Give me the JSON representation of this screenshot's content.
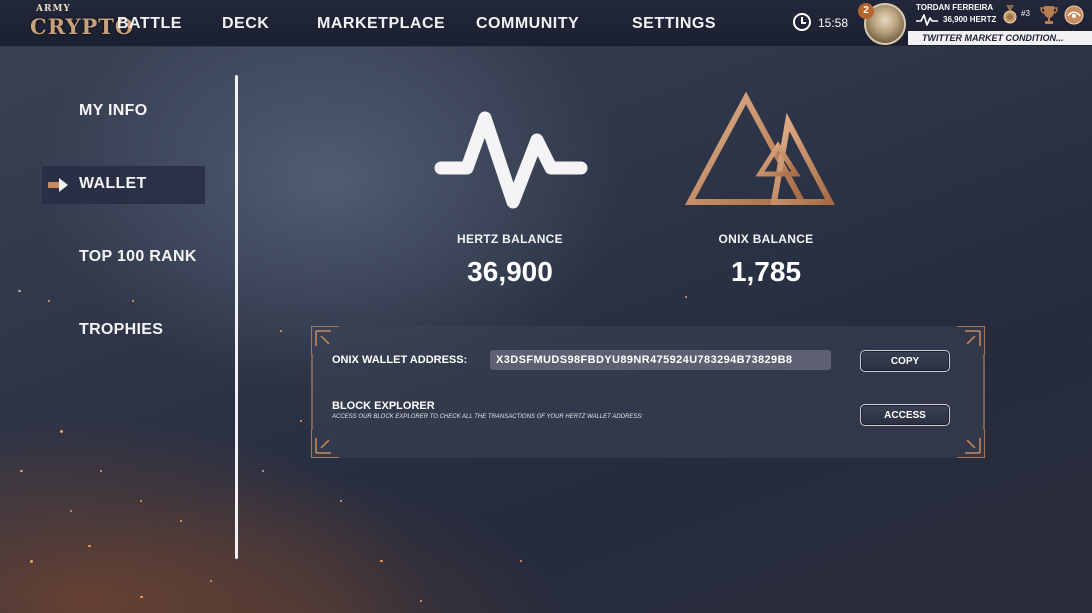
{
  "logo": {
    "top_text": "ARMY",
    "main_text": "CRYPTO"
  },
  "nav": {
    "items": [
      {
        "label": "BATTLE"
      },
      {
        "label": "DECK"
      },
      {
        "label": "MARKETPLACE"
      },
      {
        "label": "COMMUNITY"
      },
      {
        "label": "SETTINGS"
      }
    ]
  },
  "header": {
    "time": "15:58",
    "level": "2",
    "username": "TORDAN FERREIRA",
    "hertz": "36,900 HERTZ",
    "rank": "#3",
    "ticker": "TWITTER MARKET CONDITION..."
  },
  "sidebar": {
    "items": [
      {
        "label": "MY INFO"
      },
      {
        "label": "WALLET"
      },
      {
        "label": "TOP 100 RANK"
      },
      {
        "label": "TROPHIES"
      }
    ],
    "active": "WALLET"
  },
  "balances": {
    "hertz": {
      "label": "HERTZ BALANCE",
      "value": "36,900"
    },
    "onix": {
      "label": "ONIX BALANCE",
      "value": "1,785"
    }
  },
  "wallet": {
    "address_label": "ONIX WALLET ADDRESS:",
    "address": "X3DSFMUDS98FBDYU89NR475924U783294B73829B8",
    "copy_label": "COPY",
    "explorer_title": "BLOCK EXPLORER",
    "explorer_desc": "ACCESS OUR BLOCK EXPLORER TO CHECK ALL THE TRANSACTIONS OF YOUR HERTZ WALLET ADDRESS:",
    "access_label": "ACCESS"
  },
  "colors": {
    "accent_copper": "#c98a5e",
    "ticker_bg": "#f2f2f4",
    "panel_bg": "#3c4456",
    "level_badge": "#b5652a"
  },
  "icons": {
    "clock": "clock-icon",
    "hertz": "pulse-icon",
    "onix": "triangle-logo-icon",
    "medal": "medal-icon",
    "trophy": "trophy-icon",
    "coin": "coin-icon",
    "arrow": "arrow-right-icon"
  }
}
